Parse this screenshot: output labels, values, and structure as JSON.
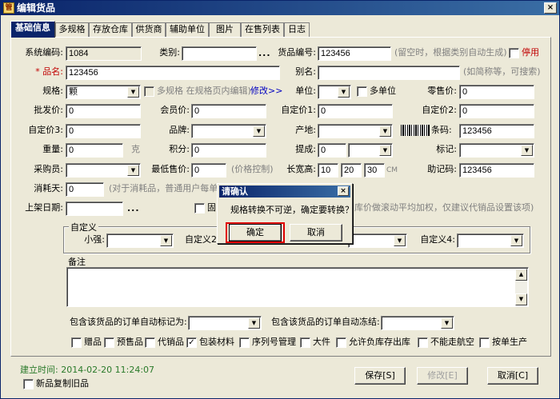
{
  "window": {
    "title": "编辑货品",
    "app_icon": "管",
    "close": "×"
  },
  "tabs": [
    "基础信息",
    "多规格",
    "存放仓库",
    "供货商",
    "辅助单位",
    "图片",
    "在售列表",
    "日志"
  ],
  "form": {
    "sys_code_label": "系统编码:",
    "sys_code_value": "1084",
    "category_label": "类别:",
    "category_value": "",
    "goods_no_label": "货品编号:",
    "goods_no_value": "123456",
    "goods_no_hint": "(留空时，根据类别自动生成)",
    "stop_label": "停用",
    "name_label": "* 品名:",
    "name_value": "123456",
    "alias_label": "别名:",
    "alias_value": "",
    "alias_hint": "(如简称等，可搜索)",
    "spec_label": "规格:",
    "spec_value": "颗",
    "multi_spec_label": "多规格 在规格页内编辑)",
    "modify_link": "修改>>",
    "unit_label": "单位:",
    "unit_value": "",
    "multi_unit_label": "多单位",
    "retail_label": "零售价:",
    "retail_value": "0",
    "wholesale_label": "批发价:",
    "wholesale_value": "0",
    "member_label": "会员价:",
    "member_value": "0",
    "custom1_label": "自定价1:",
    "custom1_value": "0",
    "custom2_label": "自定价2:",
    "custom2_value": "0",
    "custom3_label": "自定价3:",
    "custom3_value": "0",
    "brand_label": "品牌:",
    "brand_value": "",
    "origin_label": "产地:",
    "origin_value": "",
    "barcode_label": "条码:",
    "barcode_value": "123456",
    "weight_label": "重量:",
    "weight_value": "0",
    "weight_unit": "克",
    "points_label": "积分:",
    "points_value": "0",
    "commission_label": "提成:",
    "commission_value": "0",
    "tag_label": "标记:",
    "tag_value": "",
    "buyer_label": "采购员:",
    "buyer_value": "",
    "min_price_label": "最低售价:",
    "min_price_value": "0",
    "min_price_hint": "(价格控制)",
    "dims_label": "长宽高:",
    "dims_l": "10",
    "dims_w": "20",
    "dims_h": "30",
    "dims_unit": "CM",
    "mnemonic_label": "助记码:",
    "mnemonic_value": "123456",
    "consume_days_label": "消耗天:",
    "consume_days_value": "0",
    "consume_hint": "(对于消耗品，普通用户每单",
    "shelf_date_label": "上架日期:",
    "shelf_date_value": "",
    "fixed_label": "固",
    "avg_hint": "库价做滚动平均加权，仅建议代销品设置该项)",
    "custom_group_label": "自定义",
    "xiaoqiang_label": "小强:",
    "xiaoqiang_value": "",
    "custom2_group_label": "自定义2",
    "custom4_label": "自定义4:",
    "custom4_value": "",
    "notes_label": "备注",
    "order_mark_label": "包含该货品的订单自动标记为:",
    "order_mark_value": "",
    "order_freeze_label": "包含该货品的订单自动冻结:",
    "order_freeze_value": "",
    "flags": [
      {
        "label": "赠品",
        "checked": false
      },
      {
        "label": "预售品",
        "checked": false
      },
      {
        "label": "代销品",
        "checked": false
      },
      {
        "label": "包装材料",
        "checked": true
      },
      {
        "label": "序列号管理",
        "checked": false
      },
      {
        "label": "大件",
        "checked": false
      },
      {
        "label": "允许负库存出库",
        "checked": false
      },
      {
        "label": "不能走航空",
        "checked": false
      },
      {
        "label": "按单生产",
        "checked": false
      }
    ]
  },
  "footer": {
    "created": "建立时间: 2014-02-20 11:24:07",
    "copy_label": "新品复制旧品",
    "save": "保存[S]",
    "modify": "修改[E]",
    "cancel": "取消[C]"
  },
  "dialog": {
    "title": "请确认",
    "message": "规格转换不可逆，确定要转换？",
    "ok": "确定",
    "cancel": "取消",
    "close": "×"
  },
  "colors": {
    "highlight": "#e00000",
    "title_bar": "#0a246a",
    "face": "#ece9d8"
  }
}
